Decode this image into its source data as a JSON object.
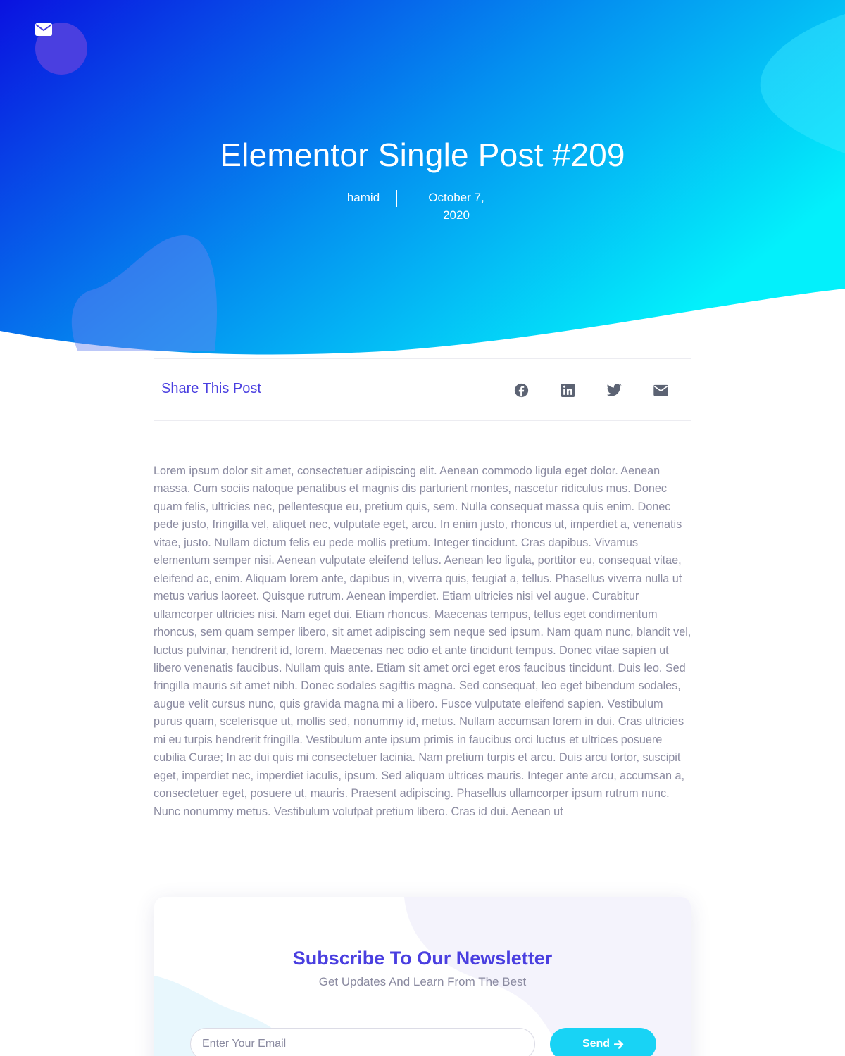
{
  "hero": {
    "title": "Elementor Single Post #209",
    "author": "hamid",
    "date": "October 7, 2020"
  },
  "share": {
    "title": "Share This Post",
    "icons": [
      "facebook-icon",
      "linkedin-icon",
      "twitter-icon",
      "envelope-icon"
    ]
  },
  "post": {
    "body": "Lorem ipsum dolor sit amet, consectetuer adipiscing elit. Aenean commodo ligula eget dolor. Aenean massa. Cum sociis natoque penatibus et magnis dis parturient montes, nascetur ridiculus mus. Donec quam felis, ultricies nec, pellentesque eu, pretium quis, sem. Nulla consequat massa quis enim. Donec pede justo, fringilla vel, aliquet nec, vulputate eget, arcu. In enim justo, rhoncus ut, imperdiet a, venenatis vitae, justo. Nullam dictum felis eu pede mollis pretium. Integer tincidunt. Cras dapibus. Vivamus elementum semper nisi. Aenean vulputate eleifend tellus. Aenean leo ligula, porttitor eu, consequat vitae, eleifend ac, enim. Aliquam lorem ante, dapibus in, viverra quis, feugiat a, tellus. Phasellus viverra nulla ut metus varius laoreet. Quisque rutrum. Aenean imperdiet. Etiam ultricies nisi vel augue. Curabitur ullamcorper ultricies nisi. Nam eget dui. Etiam rhoncus. Maecenas tempus, tellus eget condimentum rhoncus, sem quam semper libero, sit amet adipiscing sem neque sed ipsum. Nam quam nunc, blandit vel, luctus pulvinar, hendrerit id, lorem. Maecenas nec odio et ante tincidunt tempus. Donec vitae sapien ut libero venenatis faucibus. Nullam quis ante. Etiam sit amet orci eget eros faucibus tincidunt. Duis leo. Sed fringilla mauris sit amet nibh. Donec sodales sagittis magna. Sed consequat, leo eget bibendum sodales, augue velit cursus nunc, quis gravida magna mi a libero. Fusce vulputate eleifend sapien. Vestibulum purus quam, scelerisque ut, mollis sed, nonummy id, metus. Nullam accumsan lorem in dui. Cras ultricies mi eu turpis hendrerit fringilla. Vestibulum ante ipsum primis in faucibus orci luctus et ultrices posuere cubilia Curae; In ac dui quis mi consectetuer lacinia. Nam pretium turpis et arcu. Duis arcu tortor, suscipit eget, imperdiet nec, imperdiet iaculis, ipsum. Sed aliquam ultrices mauris. Integer ante arcu, accumsan a, consectetuer eget, posuere ut, mauris. Praesent adipiscing. Phasellus ullamcorper ipsum rutrum nunc. Nunc nonummy metus. Vestibulum volutpat pretium libero. Cras id dui. Aenean ut"
  },
  "newsletter": {
    "title": "Subscribe To Our Newsletter",
    "subtitle": "Get Updates And Learn From The Best",
    "email_placeholder": "Enter Your Email",
    "send_label": "Send"
  },
  "colors": {
    "hero_gradient_start": "#0a12e0",
    "hero_gradient_end": "#03f0fb",
    "accent_purple": "#4a3fe0",
    "button_cyan": "#18d3f5",
    "body_text": "#8a8aa0",
    "icon_gray": "#5c6373"
  }
}
